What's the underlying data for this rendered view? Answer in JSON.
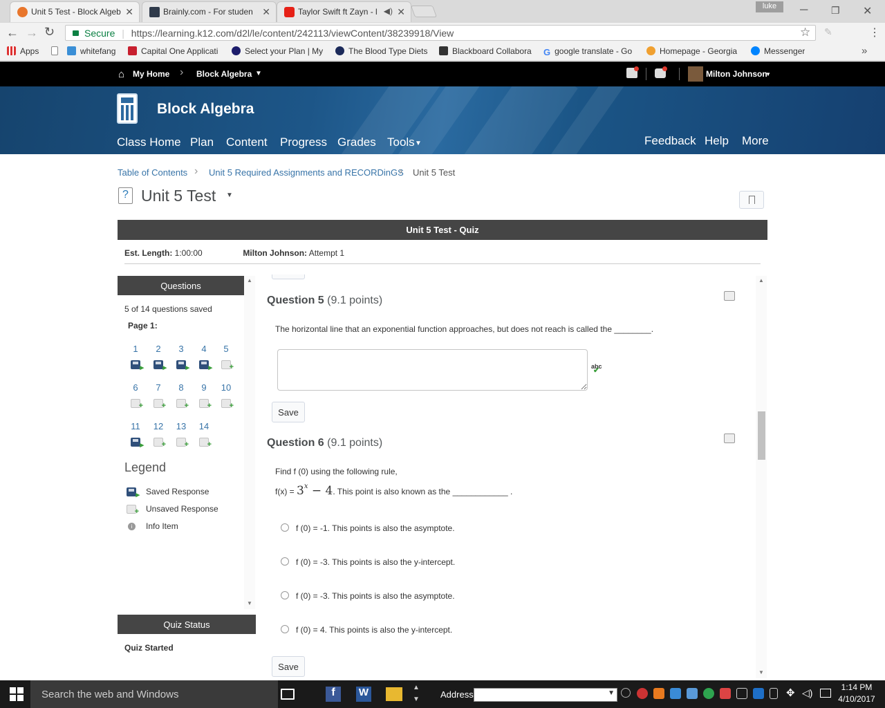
{
  "browser": {
    "tabs": [
      {
        "title": "Unit 5 Test - Block Algeb"
      },
      {
        "title": "Brainly.com - For studen"
      },
      {
        "title": "Taylor Swift ft Zayn - l"
      }
    ],
    "profile": "luke",
    "url_secure": "Secure",
    "url": "https://learning.k12.com/d2l/le/content/242113/viewContent/38239918/View",
    "bookmarks": [
      "Apps",
      "whitefang",
      "Capital One Applicati",
      "Select your Plan | My",
      "The Blood Type Diets",
      "Blackboard Collabora",
      "google translate - Go",
      "Homepage - Georgia",
      "Messenger"
    ]
  },
  "site": {
    "home": "My Home",
    "course_menu": "Block Algebra",
    "user": "Milton Johnson",
    "course_title": "Block Algebra",
    "nav": [
      "Class Home",
      "Plan",
      "Content",
      "Progress",
      "Grades",
      "Tools"
    ],
    "nav_right": [
      "Feedback",
      "Help",
      "More"
    ]
  },
  "breadcrumbs": [
    "Table of Contents",
    "Unit 5 Required Assignments and RECORDinGS",
    "Unit 5 Test"
  ],
  "page_title": "Unit 5 Test",
  "quiz": {
    "header": "Unit 5 Test - Quiz",
    "est_label": "Est. Length:",
    "est_value": "1:00:00",
    "user_label": "Milton Johnson:",
    "attempt": "Attempt 1"
  },
  "left_panel": {
    "header": "Questions",
    "saved_count": "5 of 14 questions saved",
    "page_label": "Page 1:",
    "questions": [
      {
        "n": "1",
        "saved": true
      },
      {
        "n": "2",
        "saved": true
      },
      {
        "n": "3",
        "saved": true
      },
      {
        "n": "4",
        "saved": true
      },
      {
        "n": "5",
        "saved": false
      },
      {
        "n": "6",
        "saved": false
      },
      {
        "n": "7",
        "saved": false
      },
      {
        "n": "8",
        "saved": false
      },
      {
        "n": "9",
        "saved": false
      },
      {
        "n": "10",
        "saved": false
      },
      {
        "n": "11",
        "saved": true
      },
      {
        "n": "12",
        "saved": false
      },
      {
        "n": "13",
        "saved": false
      },
      {
        "n": "14",
        "saved": false
      }
    ],
    "legend_title": "Legend",
    "legend": [
      "Saved Response",
      "Unsaved Response",
      "Info Item"
    ],
    "status_header": "Quiz Status",
    "status": "Quiz Started"
  },
  "q5": {
    "title": "Question 5",
    "points": "(9.1 points)",
    "text": "The horizontal line that an exponential function approaches, but does not reach is called the ________.",
    "spell_icon": "abc",
    "save": "Save"
  },
  "q6": {
    "title": "Question 6",
    "points": "(9.1 points)",
    "text1": "Find f (0) using the following rule,",
    "rule_prefix": "f(x) =",
    "rule_base": "3",
    "rule_exp": "x",
    "rule_tail": "− 4",
    "text2": ". This point is also known as the ____________ .",
    "options": [
      "f (0) = -1. This points is also the asymptote.",
      "f (0) = -3. This points is also the y-intercept.",
      "f (0) = -3. This points is also the asymptote.",
      "f (0) = 4. This points is also the y-intercept."
    ],
    "save": "Save"
  },
  "taskbar": {
    "search": "Search the web and Windows",
    "address_label": "Address",
    "time": "1:14 PM",
    "date": "4/10/2017"
  }
}
